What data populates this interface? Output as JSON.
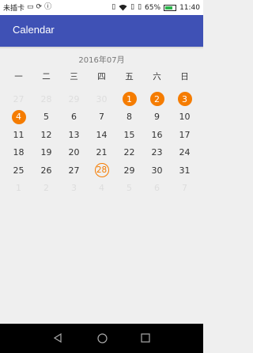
{
  "status_bar": {
    "carrier": "未插卡",
    "battery_text": "65%",
    "time": "11:40"
  },
  "app_bar": {
    "title": "Calendar"
  },
  "calendar": {
    "month_label": "2016年07月",
    "weekdays": [
      "一",
      "二",
      "三",
      "四",
      "五",
      "六",
      "日"
    ],
    "weeks": [
      [
        {
          "d": "27",
          "t": "other"
        },
        {
          "d": "28",
          "t": "other"
        },
        {
          "d": "29",
          "t": "other"
        },
        {
          "d": "30",
          "t": "other"
        },
        {
          "d": "1",
          "t": "mark"
        },
        {
          "d": "2",
          "t": "mark"
        },
        {
          "d": "3",
          "t": "mark"
        }
      ],
      [
        {
          "d": "4",
          "t": "mark"
        },
        {
          "d": "5",
          "t": ""
        },
        {
          "d": "6",
          "t": ""
        },
        {
          "d": "7",
          "t": ""
        },
        {
          "d": "8",
          "t": ""
        },
        {
          "d": "9",
          "t": ""
        },
        {
          "d": "10",
          "t": ""
        }
      ],
      [
        {
          "d": "11",
          "t": ""
        },
        {
          "d": "12",
          "t": ""
        },
        {
          "d": "13",
          "t": ""
        },
        {
          "d": "14",
          "t": ""
        },
        {
          "d": "15",
          "t": ""
        },
        {
          "d": "16",
          "t": ""
        },
        {
          "d": "17",
          "t": ""
        }
      ],
      [
        {
          "d": "18",
          "t": ""
        },
        {
          "d": "19",
          "t": ""
        },
        {
          "d": "20",
          "t": ""
        },
        {
          "d": "21",
          "t": ""
        },
        {
          "d": "22",
          "t": ""
        },
        {
          "d": "23",
          "t": ""
        },
        {
          "d": "24",
          "t": ""
        }
      ],
      [
        {
          "d": "25",
          "t": ""
        },
        {
          "d": "26",
          "t": ""
        },
        {
          "d": "27",
          "t": ""
        },
        {
          "d": "28",
          "t": "today"
        },
        {
          "d": "29",
          "t": ""
        },
        {
          "d": "30",
          "t": ""
        },
        {
          "d": "31",
          "t": ""
        }
      ],
      [
        {
          "d": "1",
          "t": "other"
        },
        {
          "d": "2",
          "t": "other"
        },
        {
          "d": "3",
          "t": "other"
        },
        {
          "d": "4",
          "t": "other"
        },
        {
          "d": "5",
          "t": "other"
        },
        {
          "d": "6",
          "t": "other"
        },
        {
          "d": "7",
          "t": "other"
        }
      ]
    ]
  },
  "colors": {
    "primary": "#3f51b5",
    "accent": "#f57c00"
  },
  "nav_bar": {
    "icons": [
      "back-icon",
      "home-icon",
      "recents-icon"
    ]
  }
}
